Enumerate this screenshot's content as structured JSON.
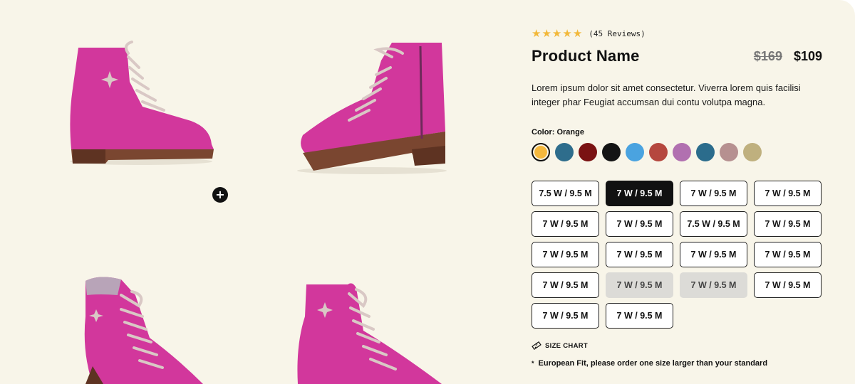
{
  "gallery": {
    "images": [
      {
        "name": "boot-side-view",
        "color": "#d2379c"
      },
      {
        "name": "boot-inner-side-view",
        "color": "#d2379c"
      },
      {
        "name": "boot-front-angle-view",
        "color": "#d2379c"
      },
      {
        "name": "boot-three-quarter-view",
        "color": "#d2379c"
      }
    ],
    "zoom_icon": "plus-icon",
    "zoom_label": "+"
  },
  "product": {
    "rating_stars": 5,
    "reviews_label": "(45 Reviews)",
    "name": "Product Name",
    "old_price": "$169",
    "price": "$109",
    "description": "Lorem ipsum dolor sit amet consectetur. Viverra lorem quis facilisi integer phar Feugiat accumsan dui contu volutpa magna."
  },
  "colors": {
    "label": "Color: Orange",
    "swatches": [
      "#f5b83d",
      "#2e6d8c",
      "#7a1212",
      "#141414",
      "#4aa3e0",
      "#b5473e",
      "#b170b0",
      "#2b6c8c",
      "#b69090",
      "#bfb07e"
    ]
  },
  "sizes": {
    "items": [
      {
        "label": "7.5 W / 9.5 M",
        "state": "default"
      },
      {
        "label": "7 W / 9.5 M",
        "state": "active"
      },
      {
        "label": "7 W / 9.5 M",
        "state": "default"
      },
      {
        "label": "7 W / 9.5 M",
        "state": "default"
      },
      {
        "label": "7 W / 9.5 M",
        "state": "default"
      },
      {
        "label": "7 W / 9.5 M",
        "state": "default"
      },
      {
        "label": "7.5 W / 9.5 M",
        "state": "default"
      },
      {
        "label": "7 W / 9.5 M",
        "state": "default"
      },
      {
        "label": "7 W / 9.5 M",
        "state": "default"
      },
      {
        "label": "7 W / 9.5 M",
        "state": "default"
      },
      {
        "label": "7 W / 9.5 M",
        "state": "default"
      },
      {
        "label": "7 W / 9.5 M",
        "state": "default"
      },
      {
        "label": "7 W / 9.5 M",
        "state": "default"
      },
      {
        "label": "7 W / 9.5 M",
        "state": "disabled"
      },
      {
        "label": "7 W / 9.5 M",
        "state": "disabled"
      },
      {
        "label": "7 W / 9.5 M",
        "state": "default"
      },
      {
        "label": "7 W / 9.5 M",
        "state": "default"
      },
      {
        "label": "7 W / 9.5 M",
        "state": "default"
      }
    ],
    "size_chart_label": "SIZE CHART",
    "size_chart_icon": "ruler-icon",
    "fit_note_mark": "*",
    "fit_note": "European Fit, please order one size larger than your standard"
  },
  "theme": {
    "background": "#f8f5e9",
    "star_color": "#f2b83a",
    "accent": "#111111"
  }
}
